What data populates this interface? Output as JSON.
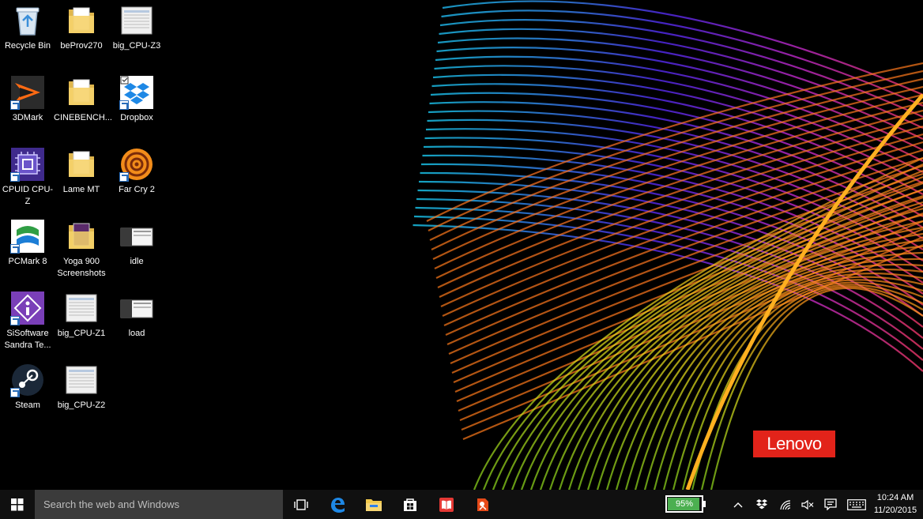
{
  "desktop": {
    "icons": [
      {
        "label": "Recycle Bin",
        "icon": "recycle-bin-icon"
      },
      {
        "label": "beProv270",
        "icon": "folder-icon"
      },
      {
        "label": "big_CPU-Z3",
        "icon": "image-file-icon"
      },
      {
        "label": "3DMark",
        "icon": "3dmark-icon"
      },
      {
        "label": "CINEBENCH...",
        "icon": "folder-icon"
      },
      {
        "label": "Dropbox",
        "icon": "dropbox-icon"
      },
      {
        "label": "CPUID CPU-Z",
        "icon": "cpuz-icon"
      },
      {
        "label": "Lame MT",
        "icon": "folder-icon"
      },
      {
        "label": "Far Cry 2",
        "icon": "farcry-icon"
      },
      {
        "label": "PCMark 8",
        "icon": "pcmark-icon"
      },
      {
        "label": "Yoga 900 Screenshots",
        "icon": "folder-icon"
      },
      {
        "label": "idle",
        "icon": "image-file-icon"
      },
      {
        "label": "SiSoftware Sandra Te...",
        "icon": "sandra-icon"
      },
      {
        "label": "big_CPU-Z1",
        "icon": "image-file-icon"
      },
      {
        "label": "load",
        "icon": "image-file-icon"
      },
      {
        "label": "Steam",
        "icon": "steam-icon"
      },
      {
        "label": "big_CPU-Z2",
        "icon": "image-file-icon"
      }
    ],
    "brand_badge": "Lenovo"
  },
  "taskbar": {
    "search_placeholder": "Search the web and Windows",
    "pinned": [
      "task-view-icon",
      "edge-icon",
      "file-explorer-icon",
      "store-icon",
      "reader-icon",
      "app-icon"
    ],
    "battery_percent": "95%",
    "battery_level": 0.95,
    "clock_time": "10:24 AM",
    "clock_date": "11/20/2015"
  },
  "colors": {
    "taskbar_bg": "#101010",
    "search_bg": "#3b3b3b",
    "lenovo_red": "#e2231a",
    "battery_green": "#4caf50",
    "edge_blue": "#1e88e5"
  }
}
